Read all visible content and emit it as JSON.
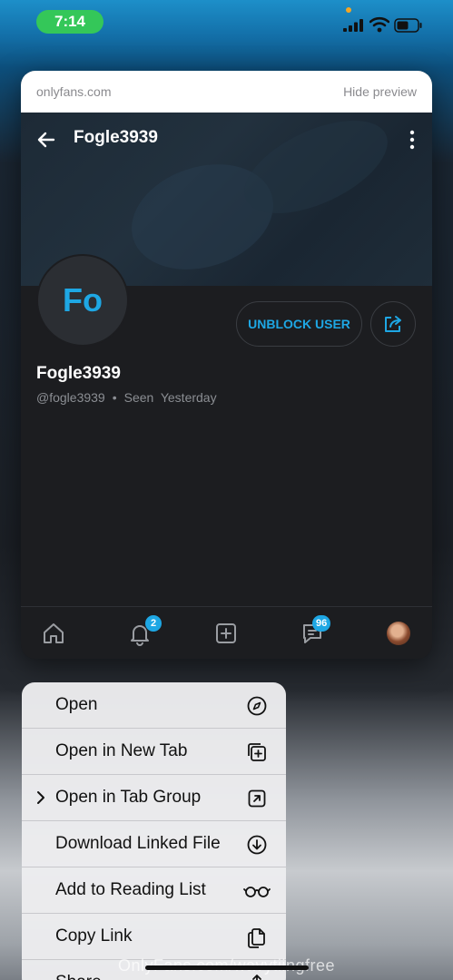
{
  "status_bar": {
    "time": "7:14"
  },
  "preview": {
    "domain": "onlyfans.com",
    "hide_label": "Hide preview",
    "profile": {
      "header_title": "Fogle3939",
      "avatar_initials": "Fo",
      "unblock_label": "UNBLOCK USER",
      "display_name": "Fogle3939",
      "handle": "@fogle3939",
      "separator": "•",
      "seen": "Seen  Yesterday"
    },
    "nav": {
      "notifications_badge": "2",
      "messages_badge": "96"
    }
  },
  "context_menu": {
    "items": [
      {
        "label": "Open",
        "icon": "compass-icon"
      },
      {
        "label": "Open in New Tab",
        "icon": "new-tab-icon"
      },
      {
        "label": "Open in Tab Group",
        "icon": "tab-group-icon",
        "has_chevron": true
      },
      {
        "label": "Download Linked File",
        "icon": "download-icon"
      },
      {
        "label": "Add to Reading List",
        "icon": "glasses-icon"
      },
      {
        "label": "Copy Link",
        "icon": "copy-icon"
      },
      {
        "label": "Share...",
        "icon": "share-icon"
      }
    ]
  },
  "watermark": "OnlyFans.com/wavytiingfree",
  "colors": {
    "accent": "#1ea7e4",
    "status_green": "#34c759"
  }
}
